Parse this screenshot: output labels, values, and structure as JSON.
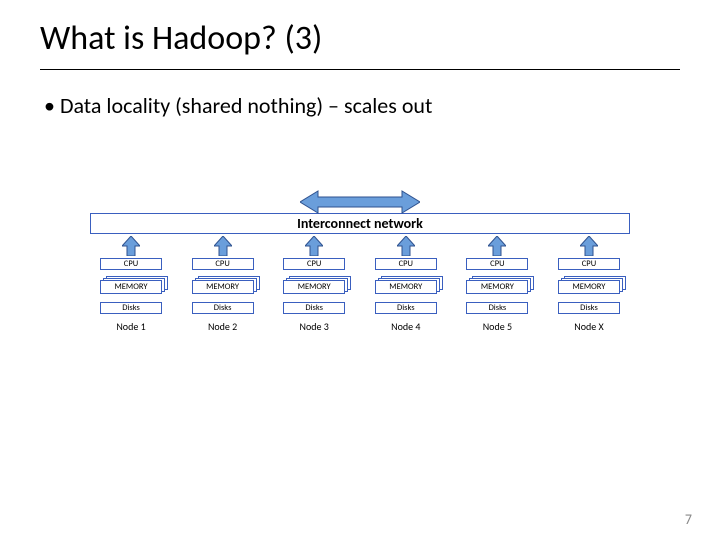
{
  "title": "What is Hadoop? (3)",
  "bullet": "Data locality (shared nothing) – scales out",
  "interconnect_label": "Interconnect network",
  "box_labels": {
    "cpu": "CPU",
    "memory": "MEMORY",
    "disks": "Disks"
  },
  "nodes": [
    {
      "label": "Node 1"
    },
    {
      "label": "Node 2"
    },
    {
      "label": "Node 3"
    },
    {
      "label": "Node 4"
    },
    {
      "label": "Node 5"
    },
    {
      "label": "Node X"
    }
  ],
  "page_number": "7"
}
